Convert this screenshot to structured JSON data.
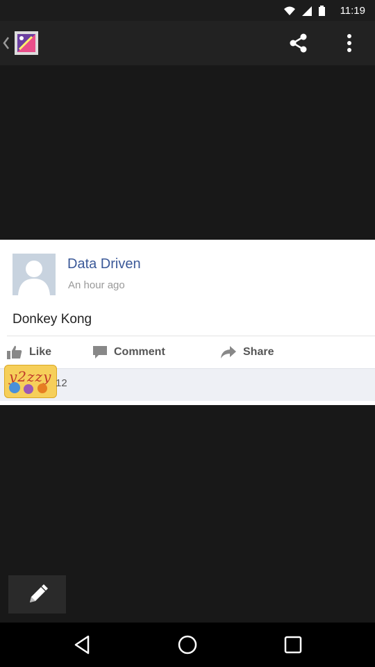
{
  "status_bar": {
    "time": "11:19"
  },
  "action_bar": {
    "share_icon": "share-icon",
    "more_icon": "overflow-menu-icon"
  },
  "post": {
    "author": "Data Driven",
    "time_ago": "An hour ago",
    "message": "Donkey Kong",
    "actions": {
      "like": "Like",
      "comment": "Comment",
      "share": "Share"
    },
    "likes_count": "12",
    "accent_color": "#3b5998"
  },
  "bottom": {
    "edit_icon": "pencil-icon"
  },
  "navigation": {
    "back": "back-icon",
    "home": "home-icon",
    "recents": "recents-icon"
  }
}
